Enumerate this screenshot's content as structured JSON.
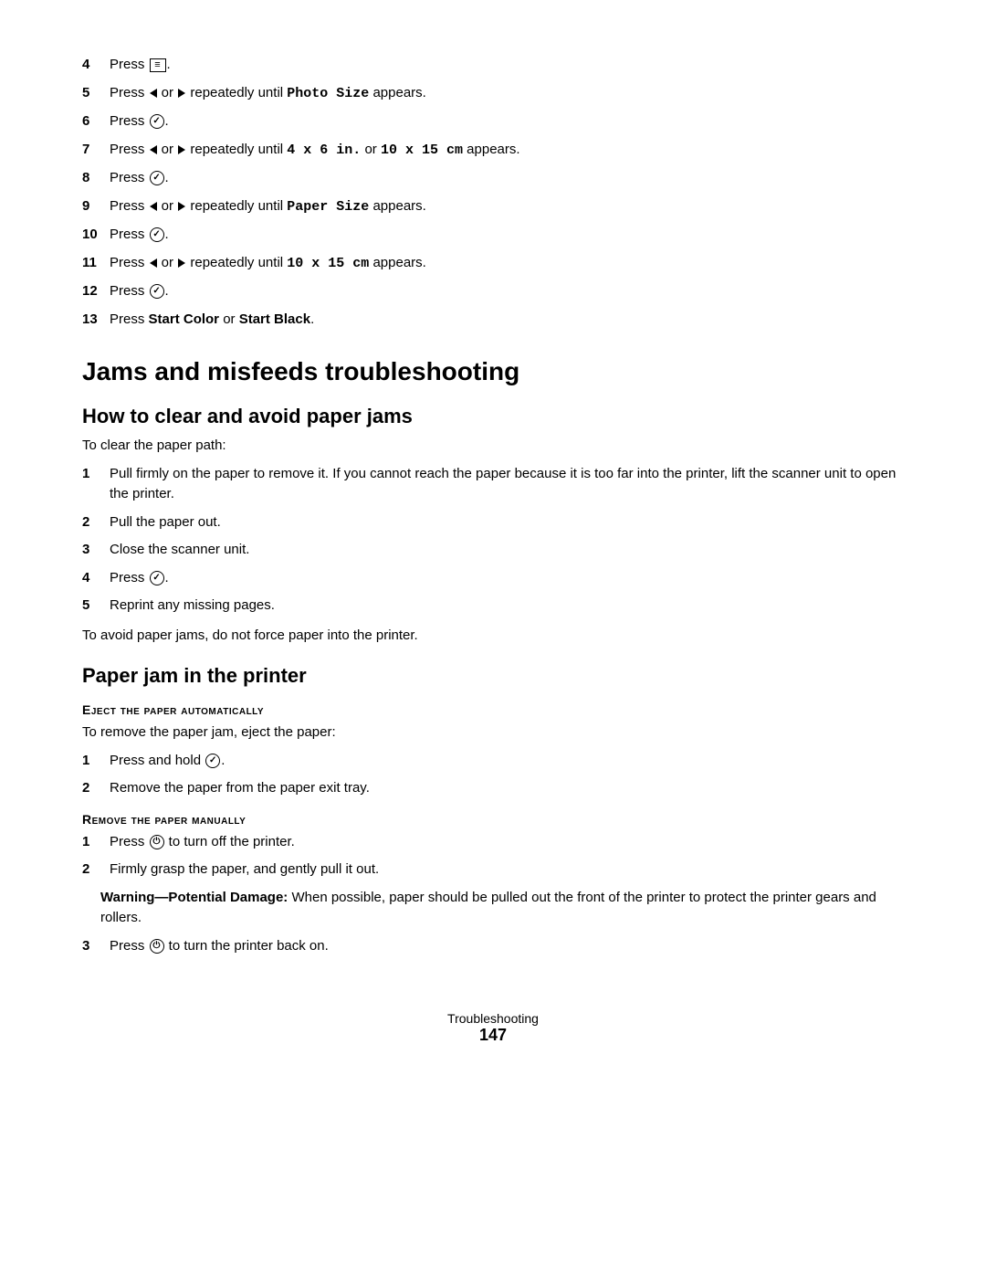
{
  "steps_top": [
    {
      "num": "4",
      "text_parts": [
        {
          "type": "text",
          "val": "Press "
        },
        {
          "type": "menu-icon"
        },
        {
          "type": "text",
          "val": "."
        }
      ]
    },
    {
      "num": "5",
      "text_parts": [
        {
          "type": "text",
          "val": "Press "
        },
        {
          "type": "arrow-left"
        },
        {
          "type": "text",
          "val": " or "
        },
        {
          "type": "arrow-right"
        },
        {
          "type": "text",
          "val": " repeatedly until "
        },
        {
          "type": "code",
          "val": "Photo Size"
        },
        {
          "type": "text",
          "val": " appears."
        }
      ]
    },
    {
      "num": "6",
      "text_parts": [
        {
          "type": "text",
          "val": "Press "
        },
        {
          "type": "circle-icon",
          "val": "✓"
        },
        {
          "type": "text",
          "val": "."
        }
      ]
    },
    {
      "num": "7",
      "text_parts": [
        {
          "type": "text",
          "val": "Press "
        },
        {
          "type": "arrow-left"
        },
        {
          "type": "text",
          "val": " or "
        },
        {
          "type": "arrow-right"
        },
        {
          "type": "text",
          "val": " repeatedly until "
        },
        {
          "type": "code",
          "val": "4 x 6 in."
        },
        {
          "type": "text",
          "val": " or "
        },
        {
          "type": "code",
          "val": "10 x 15 cm"
        },
        {
          "type": "text",
          "val": " appears."
        }
      ]
    },
    {
      "num": "8",
      "text_parts": [
        {
          "type": "text",
          "val": "Press "
        },
        {
          "type": "circle-icon",
          "val": "✓"
        },
        {
          "type": "text",
          "val": "."
        }
      ]
    },
    {
      "num": "9",
      "text_parts": [
        {
          "type": "text",
          "val": "Press "
        },
        {
          "type": "arrow-left"
        },
        {
          "type": "text",
          "val": " or "
        },
        {
          "type": "arrow-right"
        },
        {
          "type": "text",
          "val": " repeatedly until "
        },
        {
          "type": "code",
          "val": "Paper Size"
        },
        {
          "type": "text",
          "val": " appears."
        }
      ]
    },
    {
      "num": "10",
      "text_parts": [
        {
          "type": "text",
          "val": "Press "
        },
        {
          "type": "circle-icon",
          "val": "✓"
        },
        {
          "type": "text",
          "val": "."
        }
      ]
    },
    {
      "num": "11",
      "text_parts": [
        {
          "type": "text",
          "val": "Press "
        },
        {
          "type": "arrow-left"
        },
        {
          "type": "text",
          "val": " or "
        },
        {
          "type": "arrow-right"
        },
        {
          "type": "text",
          "val": " repeatedly until "
        },
        {
          "type": "code",
          "val": "10 x 15 cm"
        },
        {
          "type": "text",
          "val": " appears."
        }
      ]
    },
    {
      "num": "12",
      "text_parts": [
        {
          "type": "text",
          "val": "Press "
        },
        {
          "type": "circle-icon",
          "val": "✓"
        },
        {
          "type": "text",
          "val": "."
        }
      ]
    },
    {
      "num": "13",
      "text_parts": [
        {
          "type": "text",
          "val": "Press "
        },
        {
          "type": "bold",
          "val": "Start Color"
        },
        {
          "type": "text",
          "val": " or "
        },
        {
          "type": "bold",
          "val": "Start Black"
        },
        {
          "type": "text",
          "val": "."
        }
      ]
    }
  ],
  "section1": {
    "title": "Jams and misfeeds troubleshooting",
    "sub1_title": "How to clear and avoid paper jams",
    "intro": "To clear the paper path:",
    "steps": [
      {
        "num": "1",
        "text": "Pull firmly on the paper to remove it. If you cannot reach the paper because it is too far into the printer, lift the scanner unit to open the printer."
      },
      {
        "num": "2",
        "text": "Pull the paper out."
      },
      {
        "num": "3",
        "text": "Close the scanner unit."
      },
      {
        "num": "4",
        "text_parts": [
          {
            "type": "text",
            "val": "Press "
          },
          {
            "type": "circle-icon",
            "val": "✓"
          },
          {
            "type": "text",
            "val": "."
          }
        ]
      },
      {
        "num": "5",
        "text": "Reprint any missing pages."
      }
    ],
    "outro": "To avoid paper jams, do not force paper into the printer.",
    "sub2_title": "Paper jam in the printer",
    "eject_heading": "Eject the paper automatically",
    "eject_intro": "To remove the paper jam, eject the paper:",
    "eject_steps": [
      {
        "num": "1",
        "text_parts": [
          {
            "type": "text",
            "val": "Press and hold "
          },
          {
            "type": "circle-icon",
            "val": "✓"
          },
          {
            "type": "text",
            "val": "."
          }
        ]
      },
      {
        "num": "2",
        "text": "Remove the paper from the paper exit tray."
      }
    ],
    "remove_heading": "Remove the paper manually",
    "remove_steps": [
      {
        "num": "1",
        "text_parts": [
          {
            "type": "text",
            "val": "Press "
          },
          {
            "type": "power-icon"
          },
          {
            "type": "text",
            "val": " to turn off the printer."
          }
        ]
      },
      {
        "num": "2",
        "text": "Firmly grasp the paper, and gently pull it out."
      }
    ],
    "warning_label": "Warning—Potential Damage:",
    "warning_text": "When possible, paper should be pulled out the front of the printer to protect the printer gears and rollers.",
    "step3_parts": [
      {
        "type": "text",
        "val": "Press "
      },
      {
        "type": "power-icon"
      },
      {
        "type": "text",
        "val": " to turn the printer back on."
      }
    ]
  },
  "footer": {
    "label": "Troubleshooting",
    "page": "147"
  }
}
